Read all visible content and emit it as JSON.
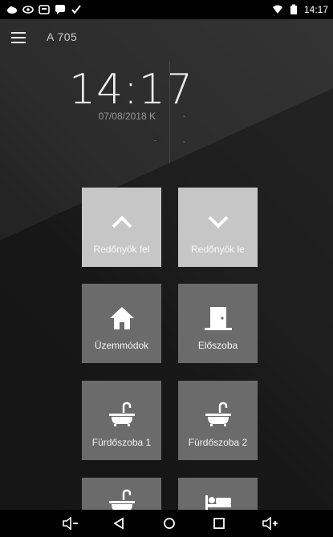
{
  "status_bar": {
    "time": "14:17",
    "left_icons": [
      "cloud-icon",
      "eye-icon",
      "square-app-icon",
      "chat-icon",
      "check-icon"
    ],
    "right_icons": [
      "wifi-icon",
      "battery-icon"
    ]
  },
  "app_bar": {
    "menu_icon": "hamburger-menu-icon",
    "title": "A 705"
  },
  "clock": {
    "time": "14:17",
    "date": "07/08/2018 K",
    "sub": "-",
    "info_lines": [
      "-",
      "-",
      "-"
    ]
  },
  "tiles": [
    {
      "label": "Redőnyök fel",
      "icon": "chevron-up-icon",
      "style": "light"
    },
    {
      "label": "Redőnyök le",
      "icon": "chevron-down-icon",
      "style": "light"
    },
    {
      "label": "Üzemmódok",
      "icon": "home-icon",
      "style": "dark"
    },
    {
      "label": "Előszoba",
      "icon": "door-icon",
      "style": "dark"
    },
    {
      "label": "Fürdőszoba 1",
      "icon": "bathtub-icon",
      "style": "dark"
    },
    {
      "label": "Fürdőszoba 2",
      "icon": "bathtub-icon",
      "style": "dark"
    },
    {
      "label": "",
      "icon": "bathtub-icon",
      "style": "dark"
    },
    {
      "label": "",
      "icon": "bed-icon",
      "style": "dark"
    }
  ],
  "nav_bar": {
    "buttons": [
      "volume-down-icon",
      "back-icon",
      "home-circle-icon",
      "recents-icon",
      "volume-up-icon"
    ]
  },
  "colors": {
    "tile_light": "#c6c6c6",
    "tile_dark": "#6b6b6b",
    "background": "#1c1c1c"
  }
}
